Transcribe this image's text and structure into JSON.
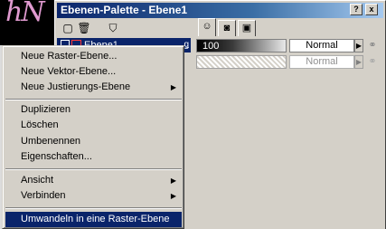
{
  "background": {
    "art_glyph": "hN"
  },
  "palette": {
    "title": "Ebenen-Palette - Ebene1",
    "title_buttons": [
      "?",
      "x"
    ],
    "toolbar_icons": [
      "new-layer-icon",
      "delete-layer-icon",
      "mask-icon"
    ],
    "layer": {
      "name": "Ebene1",
      "right_icon": "ǥ"
    },
    "tabs": [
      "☺",
      "◙",
      "▣"
    ],
    "rows": [
      {
        "opacity": "100",
        "blend_mode": "Normal",
        "enabled": true
      },
      {
        "opacity": "",
        "blend_mode": "Normal",
        "enabled": false
      }
    ]
  },
  "context_menu": {
    "groups": [
      [
        {
          "label": "Neue Raster-Ebene...",
          "submenu": false
        },
        {
          "label": "Neue Vektor-Ebene...",
          "submenu": false
        },
        {
          "label": "Neue Justierungs-Ebene",
          "submenu": true
        }
      ],
      [
        {
          "label": "Duplizieren",
          "submenu": false
        },
        {
          "label": "Löschen",
          "submenu": false
        },
        {
          "label": "Umbenennen",
          "submenu": false
        },
        {
          "label": "Eigenschaften...",
          "submenu": false
        }
      ],
      [
        {
          "label": "Ansicht",
          "submenu": true
        },
        {
          "label": "Verbinden",
          "submenu": true
        }
      ],
      [
        {
          "label": "Umwandeln in eine Raster-Ebene",
          "submenu": false,
          "highlighted": true
        }
      ]
    ]
  },
  "colors": {
    "highlight": "#0a246a",
    "face": "#d4d0c8"
  }
}
